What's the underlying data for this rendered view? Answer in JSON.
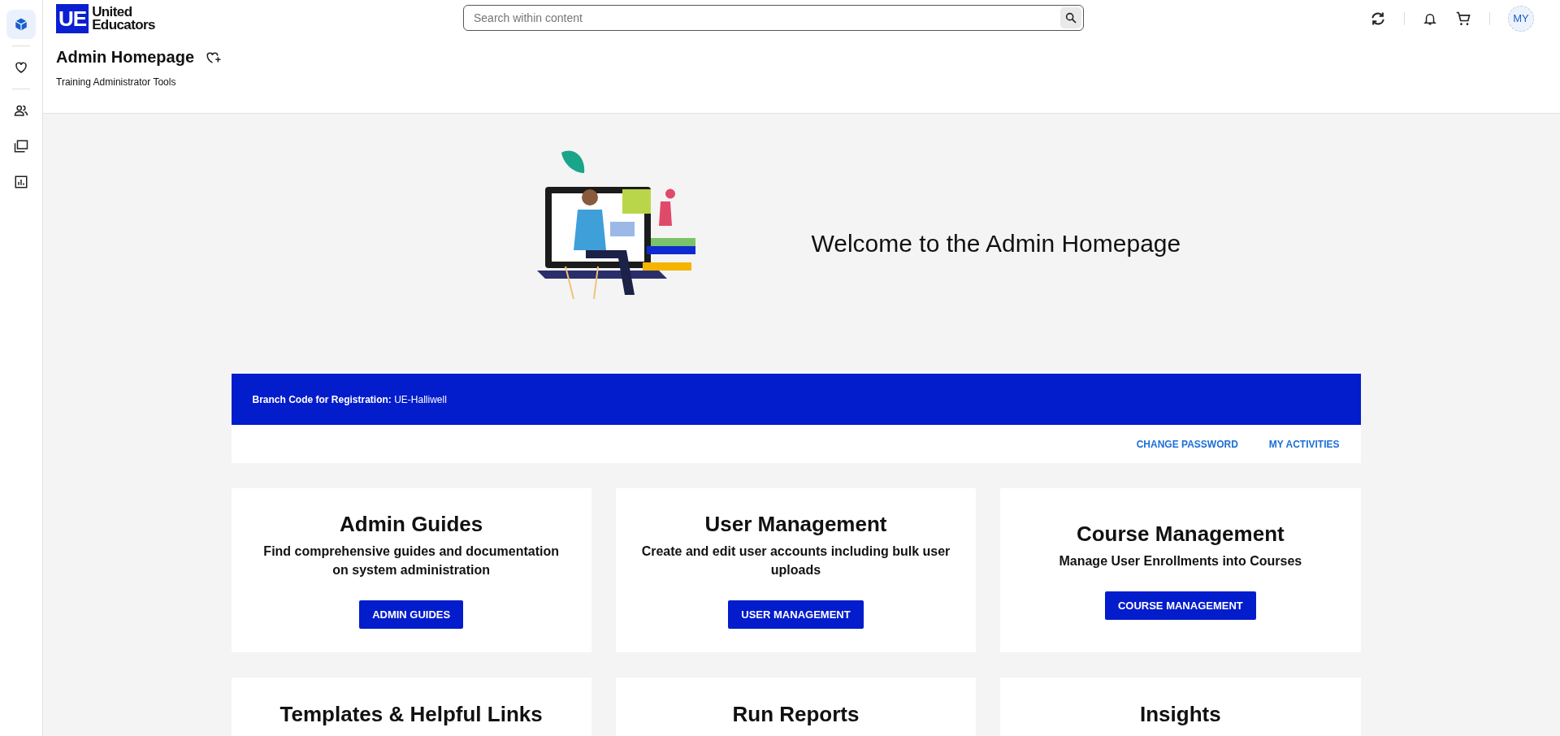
{
  "sidebar": {
    "items": [
      {
        "kind": "cube",
        "selected": true
      },
      {
        "kind": "heart",
        "selected": false
      },
      {
        "kind": "people",
        "selected": false
      },
      {
        "kind": "folders",
        "selected": false
      },
      {
        "kind": "chart",
        "selected": false
      }
    ]
  },
  "header": {
    "logo": {
      "mark": "UE",
      "line_1": "United",
      "line_2": "Educators"
    },
    "search": {
      "placeholder": "Search within content"
    },
    "avatar": "MY"
  },
  "page": {
    "title": "Admin Homepage",
    "subtitle": "Training Administrator Tools"
  },
  "hero": {
    "heading": "Welcome to the Admin Homepage"
  },
  "branch": {
    "label": "Branch Code for Registration:",
    "value": "UE-Halliwell"
  },
  "links": [
    "CHANGE PASSWORD",
    "MY ACTIVITIES"
  ],
  "cards": [
    {
      "title": "Admin Guides",
      "description": "Find comprehensive guides and documentation on system administration",
      "button": "ADMIN GUIDES"
    },
    {
      "title": "User Management",
      "description": "Create and edit user accounts including bulk user uploads",
      "button": "USER MANAGEMENT"
    },
    {
      "title": "Course Management",
      "description": "Manage User Enrollments into Courses",
      "button": "COURSE MANAGEMENT"
    },
    {
      "title": "Templates & Helpful Links"
    },
    {
      "title": "Run Reports"
    },
    {
      "title": "Insights"
    }
  ]
}
